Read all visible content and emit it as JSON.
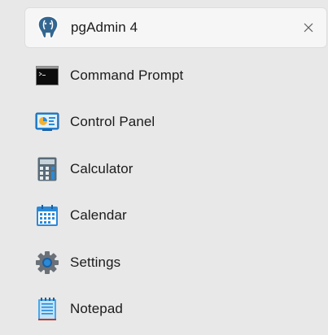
{
  "list": {
    "items": [
      {
        "label": "pgAdmin 4",
        "icon": "postgres-elephant-icon",
        "selected": true,
        "close_label": "close"
      },
      {
        "label": "Command Prompt",
        "icon": "terminal-icon"
      },
      {
        "label": "Control Panel",
        "icon": "control-panel-icon"
      },
      {
        "label": "Calculator",
        "icon": "calculator-icon"
      },
      {
        "label": "Calendar",
        "icon": "calendar-icon"
      },
      {
        "label": "Settings",
        "icon": "gear-icon"
      },
      {
        "label": "Notepad",
        "icon": "notepad-icon"
      }
    ]
  },
  "colors": {
    "background": "#e8e8e8",
    "selected_background": "#f6f6f6",
    "text": "#1b1b1b"
  }
}
